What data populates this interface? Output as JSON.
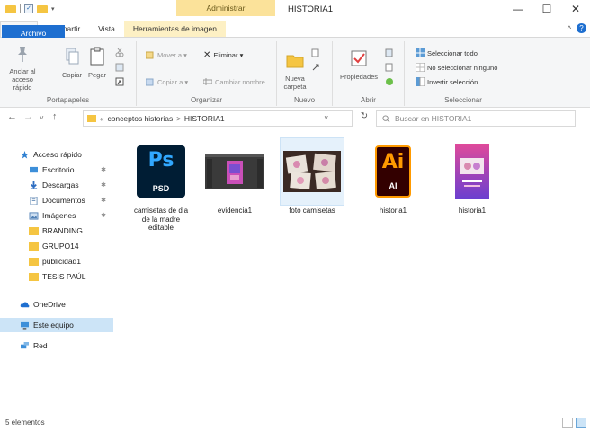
{
  "window": {
    "title": "HISTORIA1",
    "context_tab_title": "Administrar",
    "minimize_glyph": "—",
    "maximize_glyph": "☐",
    "close_glyph": "✕",
    "help_glyph": "?"
  },
  "ribbon_tabs": [
    {
      "label": "Archivo"
    },
    {
      "label": "Inicio"
    },
    {
      "label": "Compartir"
    },
    {
      "label": "Vista"
    },
    {
      "label": "Herramientas de imagen"
    }
  ],
  "ribbon": {
    "portapapeles": {
      "label": "Portapapeles",
      "anclar": "Anclar al acceso rápido",
      "copiar": "Copiar",
      "pegar": "Pegar"
    },
    "organizar": {
      "label": "Organizar",
      "mover_a": "Mover a ▾",
      "copiar_a": "Copiar a ▾",
      "eliminar": "Eliminar ▾",
      "cambiar_nombre": "Cambiar nombre"
    },
    "nuevo": {
      "label": "Nuevo",
      "nueva_carpeta": "Nueva carpeta"
    },
    "abrir": {
      "label": "Abrir",
      "propiedades": "Propiedades"
    },
    "seleccionar": {
      "label": "Seleccionar",
      "seleccionar_todo": "Seleccionar todo",
      "no_seleccionar": "No seleccionar ninguno",
      "invertir": "Invertir selección"
    }
  },
  "nav": {
    "back": "←",
    "forward": "→",
    "recent": "˅",
    "up": "↑",
    "breadcrumb": [
      {
        "label": "«"
      },
      {
        "label": "conceptos historias"
      },
      {
        "label": "HISTORIA1"
      }
    ],
    "separator": ">",
    "dropdown": "˅",
    "refresh": "↻",
    "search_placeholder": "Buscar en HISTORIA1"
  },
  "sidebar": {
    "items": [
      {
        "label": "Acceso rápido",
        "icon": "star-icon",
        "pinned": false
      },
      {
        "label": "Escritorio",
        "icon": "desktop-icon",
        "pinned": true
      },
      {
        "label": "Descargas",
        "icon": "download-icon",
        "pinned": true
      },
      {
        "label": "Documentos",
        "icon": "documents-icon",
        "pinned": true
      },
      {
        "label": "Imágenes",
        "icon": "pictures-icon",
        "pinned": true
      },
      {
        "label": "BRANDING",
        "icon": "folder-icon",
        "pinned": false
      },
      {
        "label": "GRUPO14",
        "icon": "folder-icon",
        "pinned": false
      },
      {
        "label": "publicidad1",
        "icon": "folder-icon",
        "pinned": false
      },
      {
        "label": "TESIS PAÚL",
        "icon": "folder-icon",
        "pinned": false
      },
      {
        "label": "OneDrive",
        "icon": "cloud-icon",
        "pinned": false
      },
      {
        "label": "Este equipo",
        "icon": "computer-icon",
        "pinned": false
      },
      {
        "label": "Red",
        "icon": "network-icon",
        "pinned": false
      }
    ],
    "pin_glyph": "✱"
  },
  "files": [
    {
      "name": "camisetas de dia de la madre editable",
      "type": "psd",
      "icon_text": "Ps",
      "icon_sub": "PSD"
    },
    {
      "name": "evidencia1",
      "type": "image"
    },
    {
      "name": "foto camisetas",
      "type": "image",
      "selected": true
    },
    {
      "name": "historia1",
      "type": "ai",
      "icon_text": "Ai",
      "icon_sub": "AI"
    },
    {
      "name": "historia1",
      "type": "image"
    }
  ],
  "status": {
    "count": "5 elementos"
  },
  "colors": {
    "accent": "#1e6fd0",
    "selection": "#cce4f7",
    "folder": "#f5c542",
    "context_tab": "#fbe29a"
  }
}
